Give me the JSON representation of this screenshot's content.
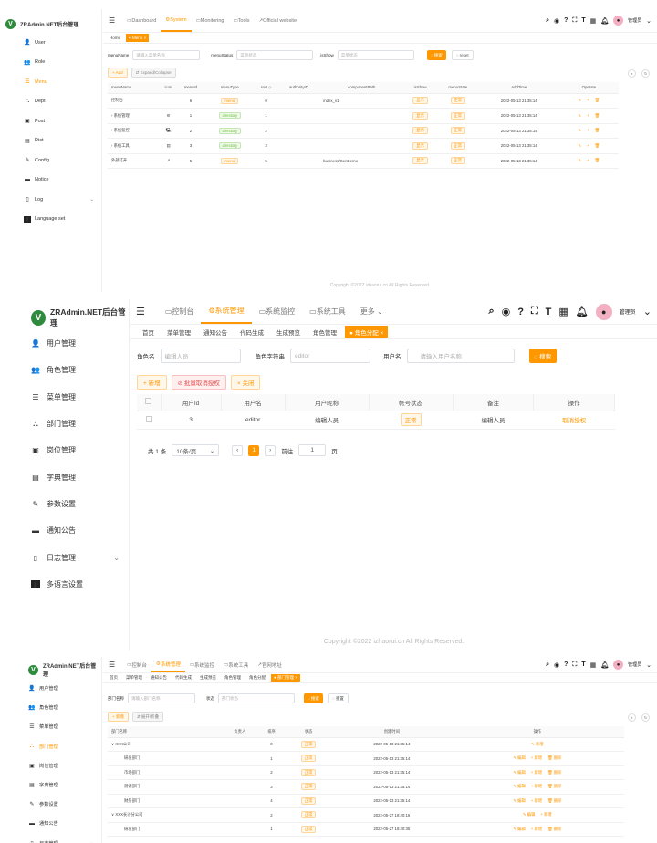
{
  "brand": {
    "name": "ZRAdmin.NET后台管理",
    "logo_letter": "V",
    "accent": "#ff9800",
    "logo_color": "#2e8b3e"
  },
  "p1": {
    "sidebar": [
      {
        "icon": "user-icon",
        "glyph": "👤",
        "label": "User"
      },
      {
        "icon": "role-icon",
        "glyph": "👥",
        "label": "Role"
      },
      {
        "icon": "menu-icon",
        "glyph": "☰",
        "label": "Menu",
        "active": true
      },
      {
        "icon": "dept-icon",
        "glyph": "⛬",
        "label": "Dept"
      },
      {
        "icon": "post-icon",
        "glyph": "▣",
        "label": "Post"
      },
      {
        "icon": "dict-icon",
        "glyph": "▤",
        "label": "Dict"
      },
      {
        "icon": "config-icon",
        "glyph": "✎",
        "label": "Config"
      },
      {
        "icon": "notice-icon",
        "glyph": "▬",
        "label": "Notice"
      },
      {
        "icon": "log-icon",
        "glyph": "▯",
        "label": "Log",
        "caret": true
      },
      {
        "icon": "language-icon",
        "glyph": "▮",
        "label": "Language set"
      }
    ],
    "topnav": [
      {
        "glyph": "▭",
        "label": "Dashboard"
      },
      {
        "glyph": "⚙",
        "label": "System",
        "active": true
      },
      {
        "glyph": "▭",
        "label": "Monitoring"
      },
      {
        "glyph": "▭",
        "label": "Tools"
      },
      {
        "glyph": "↗",
        "label": "Official website"
      }
    ],
    "tags": [
      {
        "label": "Home"
      },
      {
        "label": "● Menu ×",
        "active": true
      }
    ],
    "filters": {
      "menuname_label": "menuName",
      "menuname_ph": "请输入菜单名称",
      "menustatus_label": "menuStatus",
      "menustatus_ph": "菜单状态",
      "isshow_label": "isShow",
      "isshow_ph": "菜单状态",
      "search": "◌ 搜索",
      "reset": "◌ reset"
    },
    "actions": {
      "add": "+ Add",
      "expand": "⇵ Expand/Collapse"
    },
    "columns": [
      "menuName",
      "icon",
      "menuId",
      "menuType",
      "sort ◇",
      "authorityID",
      "componentPath",
      "isShow",
      "menuState",
      "AddTime",
      "Operate"
    ],
    "rows": [
      {
        "name": "控制台",
        "icon": "",
        "id": "6",
        "type": "menu",
        "tt": "o",
        "sort": "0",
        "auth": "",
        "path": "index_v1",
        "show": "显示",
        "state": "正常",
        "time": "2022-05-13 21:35:14"
      },
      {
        "name": "› 系统管理",
        "icon": "⚙",
        "id": "1",
        "type": "directory",
        "tt": "g",
        "sort": "1",
        "auth": "",
        "path": "",
        "show": "显示",
        "state": "正常",
        "time": "2022-05-13 21:35:14"
      },
      {
        "name": "› 系统监控",
        "icon": "🖳",
        "id": "2",
        "type": "directory",
        "tt": "g",
        "sort": "2",
        "auth": "",
        "path": "",
        "show": "显示",
        "state": "正常",
        "time": "2022-05-13 21:35:14"
      },
      {
        "name": "› 系统工具",
        "icon": "▤",
        "id": "3",
        "type": "directory",
        "tt": "g",
        "sort": "3",
        "auth": "",
        "path": "",
        "show": "显示",
        "state": "正常",
        "time": "2022-05-13 21:35:14"
      },
      {
        "name": "外部打开",
        "icon": "↗",
        "id": "5",
        "type": "menu",
        "tt": "o",
        "sort": "5",
        "auth": "",
        "path": "business/GenDemo",
        "show": "显示",
        "state": "正常",
        "time": "2022-05-13 21:35:14"
      }
    ],
    "ops": [
      "✎",
      "+",
      "🗑"
    ],
    "footer": "Copyright ©2022 izhaorui.cn All Rights Reserved."
  },
  "p2": {
    "sidebar": [
      {
        "icon": "user-icon",
        "glyph": "👤",
        "label": "用户管理"
      },
      {
        "icon": "role-icon",
        "glyph": "👥",
        "label": "角色管理"
      },
      {
        "icon": "menu-icon",
        "glyph": "☰",
        "label": "菜单管理"
      },
      {
        "icon": "dept-icon",
        "glyph": "⛬",
        "label": "部门管理"
      },
      {
        "icon": "post-icon",
        "glyph": "▣",
        "label": "岗位管理"
      },
      {
        "icon": "dict-icon",
        "glyph": "▤",
        "label": "字典管理"
      },
      {
        "icon": "config-icon",
        "glyph": "✎",
        "label": "参数设置"
      },
      {
        "icon": "notice-icon",
        "glyph": "▬",
        "label": "通知公告"
      },
      {
        "icon": "log-icon",
        "glyph": "▯",
        "label": "日志管理",
        "caret": true
      },
      {
        "icon": "language-icon",
        "glyph": "▮",
        "label": "多语言设置"
      }
    ],
    "topnav": [
      {
        "glyph": "▭",
        "label": "控制台"
      },
      {
        "glyph": "⚙",
        "label": "系统管理",
        "active": true
      },
      {
        "glyph": "▭",
        "label": "系统监控"
      },
      {
        "glyph": "▭",
        "label": "系统工具"
      },
      {
        "glyph": "",
        "label": "更多 ⌄"
      }
    ],
    "tags": [
      {
        "label": "首页"
      },
      {
        "label": "菜单管理"
      },
      {
        "label": "通知公告"
      },
      {
        "label": "代码生成"
      },
      {
        "label": "生成预览"
      },
      {
        "label": "角色管理"
      },
      {
        "label": "● 角色分配 ×",
        "active": true
      }
    ],
    "filters": {
      "role_label": "角色名",
      "role_val": "编辑人员",
      "perm_label": "角色字符串",
      "perm_val": "editor",
      "user_label": "用户名",
      "user_ph": "请输入用户名称",
      "search": "◌ 搜索"
    },
    "actions": {
      "add": "+ 新增",
      "batch": "⊘ 批量取消授权",
      "close": "× 关闭"
    },
    "columns": [
      "",
      "用户Id",
      "用户名",
      "用户昵称",
      "帐号状态",
      "备注",
      "操作"
    ],
    "rows": [
      {
        "id": "3",
        "name": "editor",
        "nick": "编辑人员",
        "status": "正常",
        "remark": "编辑人员",
        "op": "取消授权"
      }
    ],
    "pager": {
      "total": "共 1 条",
      "size": "10条/页",
      "prev": "‹",
      "page": "1",
      "next": "›",
      "goto": "前往",
      "goto_val": "1",
      "unit": "页"
    },
    "footer": "Copyright ©2022 izhaorui.cn All Rights Reserved."
  },
  "p3": {
    "sidebar": [
      {
        "icon": "user-icon",
        "glyph": "👤",
        "label": "用户管理"
      },
      {
        "icon": "role-icon",
        "glyph": "👥",
        "label": "角色管理"
      },
      {
        "icon": "menu-icon",
        "glyph": "☰",
        "label": "菜单管理"
      },
      {
        "icon": "dept-icon",
        "glyph": "⛬",
        "label": "部门管理",
        "active": true
      },
      {
        "icon": "post-icon",
        "glyph": "▣",
        "label": "岗位管理"
      },
      {
        "icon": "dict-icon",
        "glyph": "▤",
        "label": "字典管理"
      },
      {
        "icon": "config-icon",
        "glyph": "✎",
        "label": "参数设置"
      },
      {
        "icon": "notice-icon",
        "glyph": "▬",
        "label": "通知公告"
      },
      {
        "icon": "log-icon",
        "glyph": "▯",
        "label": "日志管理",
        "caret": true
      }
    ],
    "topnav": [
      {
        "glyph": "▭",
        "label": "控制台"
      },
      {
        "glyph": "⚙",
        "label": "系统管理",
        "active": true
      },
      {
        "glyph": "▭",
        "label": "系统监控"
      },
      {
        "glyph": "▭",
        "label": "系统工具"
      },
      {
        "glyph": "↗",
        "label": "官网地址"
      }
    ],
    "tags": [
      {
        "label": "首页"
      },
      {
        "label": "菜单管理"
      },
      {
        "label": "通知公告"
      },
      {
        "label": "代码生成"
      },
      {
        "label": "生成预览"
      },
      {
        "label": "角色管理"
      },
      {
        "label": "角色分配"
      },
      {
        "label": "● 部门管理 ×",
        "active": true
      }
    ],
    "filters": {
      "dept_label": "部门名称",
      "dept_ph": "请输入部门名称",
      "status_label": "状态",
      "status_ph": "部门状态",
      "search": "◌ 搜索",
      "reset": "◌ 重置"
    },
    "actions": {
      "add": "+ 新增",
      "expand": "⇵ 展开/折叠"
    },
    "columns": [
      "部门名称",
      "负责人",
      "排序",
      "状态",
      "创建时间",
      "操作"
    ],
    "rows": [
      {
        "name": "∨ XXX公司",
        "leader": "",
        "sort": "0",
        "status": "正常",
        "time": "2022-05-13 21:35:14",
        "ops": [
          "✎ 新增"
        ],
        "indent": 0
      },
      {
        "name": "研发部门",
        "leader": "",
        "sort": "1",
        "status": "正常",
        "time": "2022-05-13 21:35:14",
        "ops": [
          "✎ 编辑",
          "+ 新增",
          "🗑 删除"
        ],
        "indent": 1
      },
      {
        "name": "市场部门",
        "leader": "",
        "sort": "2",
        "status": "正常",
        "time": "2022-05-13 21:35:14",
        "ops": [
          "✎ 编辑",
          "+ 新增",
          "🗑 删除"
        ],
        "indent": 1
      },
      {
        "name": "测试部门",
        "leader": "",
        "sort": "3",
        "status": "正常",
        "time": "2022-05-13 21:35:14",
        "ops": [
          "✎ 编辑",
          "+ 新增",
          "🗑 删除"
        ],
        "indent": 1
      },
      {
        "name": "财务部门",
        "leader": "",
        "sort": "4",
        "status": "正常",
        "time": "2022-05-13 21:35:14",
        "ops": [
          "✎ 编辑",
          "+ 新增",
          "🗑 删除"
        ],
        "indent": 1
      },
      {
        "name": "∨ XXX长沙分公司",
        "leader": "",
        "sort": "2",
        "status": "正常",
        "time": "2022-05-27 18:40:16",
        "ops": [
          "✎ 编辑",
          "+ 新增"
        ],
        "indent": 0
      },
      {
        "name": "研发部门",
        "leader": "",
        "sort": "1",
        "status": "正常",
        "time": "2022-05-27 18:40:35",
        "ops": [
          "✎ 编辑",
          "+ 新增",
          "🗑 删除"
        ],
        "indent": 1
      }
    ]
  },
  "user": {
    "name": "管理员"
  }
}
